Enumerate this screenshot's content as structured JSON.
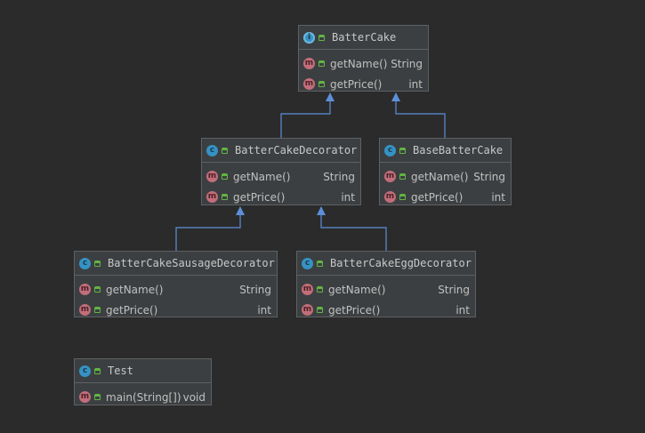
{
  "colors": {
    "background": "#2b2b2b",
    "box": "#3c3f41",
    "border": "#5e6164",
    "edge": "#5c8fd9",
    "class_icon": "#3592c4",
    "method_icon": "#c16e7a",
    "visibility_icon": "#62b543"
  },
  "icon_glyphs": {
    "class": "c",
    "interface": "i",
    "method": "m"
  },
  "classes": [
    {
      "id": "battercake",
      "name": "BatterCake",
      "kind": "interface",
      "icon": "interface-icon",
      "methods": [
        {
          "name": "getName()",
          "type": "String"
        },
        {
          "name": "getPrice()",
          "type": "int"
        }
      ]
    },
    {
      "id": "battercakedecorator",
      "name": "BatterCakeDecorator",
      "kind": "class",
      "icon": "class-icon",
      "methods": [
        {
          "name": "getName()",
          "type": "String"
        },
        {
          "name": "getPrice()",
          "type": "int"
        }
      ]
    },
    {
      "id": "basebattercake",
      "name": "BaseBatterCake",
      "kind": "class",
      "icon": "class-icon",
      "methods": [
        {
          "name": "getName()",
          "type": "String"
        },
        {
          "name": "getPrice()",
          "type": "int"
        }
      ]
    },
    {
      "id": "sausagedecorator",
      "name": "BatterCakeSausageDecorator",
      "kind": "class",
      "icon": "class-icon",
      "methods": [
        {
          "name": "getName()",
          "type": "String"
        },
        {
          "name": "getPrice()",
          "type": "int"
        }
      ]
    },
    {
      "id": "eggdecorator",
      "name": "BatterCakeEggDecorator",
      "kind": "class",
      "icon": "class-icon",
      "methods": [
        {
          "name": "getName()",
          "type": "String"
        },
        {
          "name": "getPrice()",
          "type": "int"
        }
      ]
    },
    {
      "id": "test",
      "name": "Test",
      "kind": "class",
      "icon": "class-icon",
      "methods": [
        {
          "name": "main(String[])",
          "type": "void"
        }
      ]
    }
  ],
  "relations": [
    {
      "from": "battercakedecorator",
      "to": "battercake",
      "type": "implements"
    },
    {
      "from": "basebattercake",
      "to": "battercake",
      "type": "implements"
    },
    {
      "from": "sausagedecorator",
      "to": "battercakedecorator",
      "type": "extends"
    },
    {
      "from": "eggdecorator",
      "to": "battercakedecorator",
      "type": "extends"
    }
  ]
}
